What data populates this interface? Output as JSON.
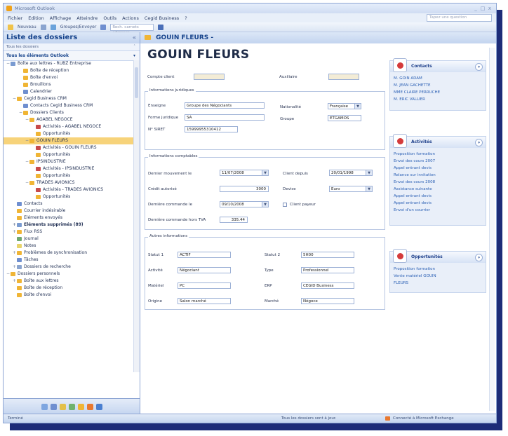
{
  "window": {
    "title": "Microsoft Outlook",
    "controls": [
      "_",
      "□",
      "x"
    ]
  },
  "menubar": {
    "items": [
      "Fichier",
      "Edition",
      "Affichage",
      "Atteindre",
      "Outils",
      "Actions",
      "Cegid Business",
      "?"
    ],
    "ask_placeholder": "Tapez une question"
  },
  "toolbar": {
    "new_label": "Nouveau",
    "groupes_label": "Groupes/Envoyer",
    "address_placeholder": "Rech. carnets adresses"
  },
  "left_pane": {
    "header": "Liste des dossiers",
    "subheader": "Tous les dossiers",
    "all_items": "Tous les éléments Outlook",
    "tree": [
      {
        "label": "Boîte aux lettres - RUBZ Entreprise",
        "level": 0,
        "exp": "−",
        "color": "#7a9bd1"
      },
      {
        "label": "Boîte de réception",
        "level": 2,
        "exp": "",
        "color": "#f0b535"
      },
      {
        "label": "Boîte d'envoi",
        "level": 2,
        "exp": "",
        "color": "#f0b535"
      },
      {
        "label": "Brouillons",
        "level": 2,
        "exp": "",
        "color": "#f0b535"
      },
      {
        "label": "Calendrier",
        "level": 2,
        "exp": "",
        "color": "#6f8fd0"
      },
      {
        "label": "Cegid Business CRM",
        "level": 1,
        "exp": "−",
        "color": "#f0b535"
      },
      {
        "label": "Contacts Cegid Business CRM",
        "level": 2,
        "exp": "",
        "color": "#6f8fd0"
      },
      {
        "label": "Dossiers Clients",
        "level": 2,
        "exp": "−",
        "color": "#f0b535"
      },
      {
        "label": "AGABEL NEGOCE",
        "level": 3,
        "exp": "−",
        "color": "#f0b535"
      },
      {
        "label": "Activités - AGABEL NEGOCE",
        "level": 4,
        "exp": "",
        "color": "#c74b4b"
      },
      {
        "label": "Opportunités",
        "level": 4,
        "exp": "",
        "color": "#f0b535"
      },
      {
        "label": "GOUIN FLEURS",
        "level": 3,
        "exp": "−",
        "color": "#f0b535",
        "selected": true
      },
      {
        "label": "Activités - GOUIN FLEURS",
        "level": 4,
        "exp": "",
        "color": "#c74b4b"
      },
      {
        "label": "Opportunités",
        "level": 4,
        "exp": "",
        "color": "#f0b535"
      },
      {
        "label": "IPSINDUSTRIE",
        "level": 3,
        "exp": "−",
        "color": "#f0b535"
      },
      {
        "label": "Activités - IPSINDUSTRIE",
        "level": 4,
        "exp": "",
        "color": "#c74b4b"
      },
      {
        "label": "Opportunités",
        "level": 4,
        "exp": "",
        "color": "#f0b535"
      },
      {
        "label": "TRADES AVIONICS",
        "level": 3,
        "exp": "−",
        "color": "#f0b535"
      },
      {
        "label": "Activités - TRADES AVIONICS",
        "level": 4,
        "exp": "",
        "color": "#c74b4b"
      },
      {
        "label": "Opportunités",
        "level": 4,
        "exp": "",
        "color": "#f0b535"
      },
      {
        "label": "Contacts",
        "level": 1,
        "exp": "",
        "color": "#6f8fd0"
      },
      {
        "label": "Courrier indésirable",
        "level": 1,
        "exp": "",
        "color": "#f0b535"
      },
      {
        "label": "Eléments envoyés",
        "level": 1,
        "exp": "",
        "color": "#f0b535"
      },
      {
        "label": "Eléments supprimés (89)",
        "level": 1,
        "exp": "+",
        "color": "#7a9bd1",
        "bold": true
      },
      {
        "label": "Flux RSS",
        "level": 1,
        "exp": "+",
        "color": "#f0b535"
      },
      {
        "label": "Journal",
        "level": 1,
        "exp": "",
        "color": "#6fa86f"
      },
      {
        "label": "Notes",
        "level": 1,
        "exp": "",
        "color": "#e8d46a"
      },
      {
        "label": "Problèmes de synchronisation",
        "level": 1,
        "exp": "+",
        "color": "#f0b535"
      },
      {
        "label": "Tâches",
        "level": 1,
        "exp": "",
        "color": "#6f8fd0"
      },
      {
        "label": "Dossiers de recherche",
        "level": 1,
        "exp": "+",
        "color": "#8aa4cf"
      },
      {
        "label": "Dossiers personnels",
        "level": 0,
        "exp": "−",
        "color": "#f0b535"
      },
      {
        "label": "Boîte aux lettres",
        "level": 1,
        "exp": "+",
        "color": "#f0b535"
      },
      {
        "label": "Boîte de réception",
        "level": 1,
        "exp": "",
        "color": "#f0b535"
      },
      {
        "label": "Boîte d'envoi",
        "level": 1,
        "exp": "",
        "color": "#f0b535"
      }
    ],
    "nav_colors": [
      "#7ea6e0",
      "#6f8fd0",
      "#e3c04a",
      "#6fb26f",
      "#f0b535",
      "#e8782f",
      "#4a7fd0"
    ]
  },
  "main": {
    "header": "GOUIN FLEURS -",
    "title": "GOUIN FLEURS",
    "compte_label": "Compte client",
    "compte_value": "",
    "auxiliaire_label": "Auxiliaire",
    "auxiliaire_value": "",
    "juridique": {
      "legend": "Informations juridiques",
      "enseigne_label": "Enseigne",
      "enseigne_value": "Groupe des Négociants",
      "forme_label": "Forme juridique",
      "forme_value": "SA",
      "siret_label": "N° SIRET",
      "siret_value": "15999955310412",
      "nationalite_label": "Nationalité",
      "nationalite_value": "Française",
      "groupe_label": "Groupe",
      "groupe_value": "ETGAMOS"
    },
    "comptable": {
      "legend": "Informations comptables",
      "mouvement_label": "Dernier mouvement le",
      "mouvement_value": "11/07/2008",
      "client_label": "Client depuis",
      "client_value": "20/01/1998",
      "credit_label": "Crédit autorisé",
      "credit_value": "3000",
      "devise_label": "Devise",
      "devise_value": "Euro",
      "commande_label": "Dernière commande le",
      "commande_value": "09/10/2008",
      "payeur_label": "Client payeur",
      "commande_ht_label": "Dernière commande hors TVA",
      "commande_ht_value": "335.44"
    },
    "autres": {
      "legend": "Autres informations",
      "statut1_label": "Statut 1",
      "statut1_value": "ACTIF",
      "statut2_label": "Statut 2",
      "statut2_value": "5H00",
      "activite_label": "Activité",
      "activite_value": "Négociant",
      "type_label": "Type",
      "type_value": "Professionnel",
      "materiel_label": "Matériel",
      "materiel_value": "PC",
      "erp_label": "ERP",
      "erp_value": "CEGID Business",
      "origine_label": "Origine",
      "origine_value": "Salon marché",
      "marche_label": "Marché",
      "marche_value": "Négoce"
    }
  },
  "right_panel": {
    "contacts": {
      "title": "Contacts",
      "links": [
        "M. GOIN ADAM",
        "M. JEAN GACHETTE",
        "MME CLAIRE PERRUCHE",
        "M. ERIC VALLIER"
      ]
    },
    "activites": {
      "title": "Activités",
      "links": [
        "Proposition formation",
        "Envoi des cours 2007",
        "Appel entrant devis",
        "Relance sur invitation",
        "Envoi des cours 2008",
        "Assistance suivante",
        "Appel entrant devis",
        "Appel entrant devis",
        "Envoi d'un courrier"
      ]
    },
    "opportunites": {
      "title": "Opportunités",
      "links": [
        "Proposition formation",
        "Vente matériel GOUIN FLEURS"
      ]
    }
  },
  "status": {
    "left": "Terminé",
    "all_up_to_date": "Tous les dossiers sont à jour.",
    "exchange": "Connecté à Microsoft Exchange"
  }
}
